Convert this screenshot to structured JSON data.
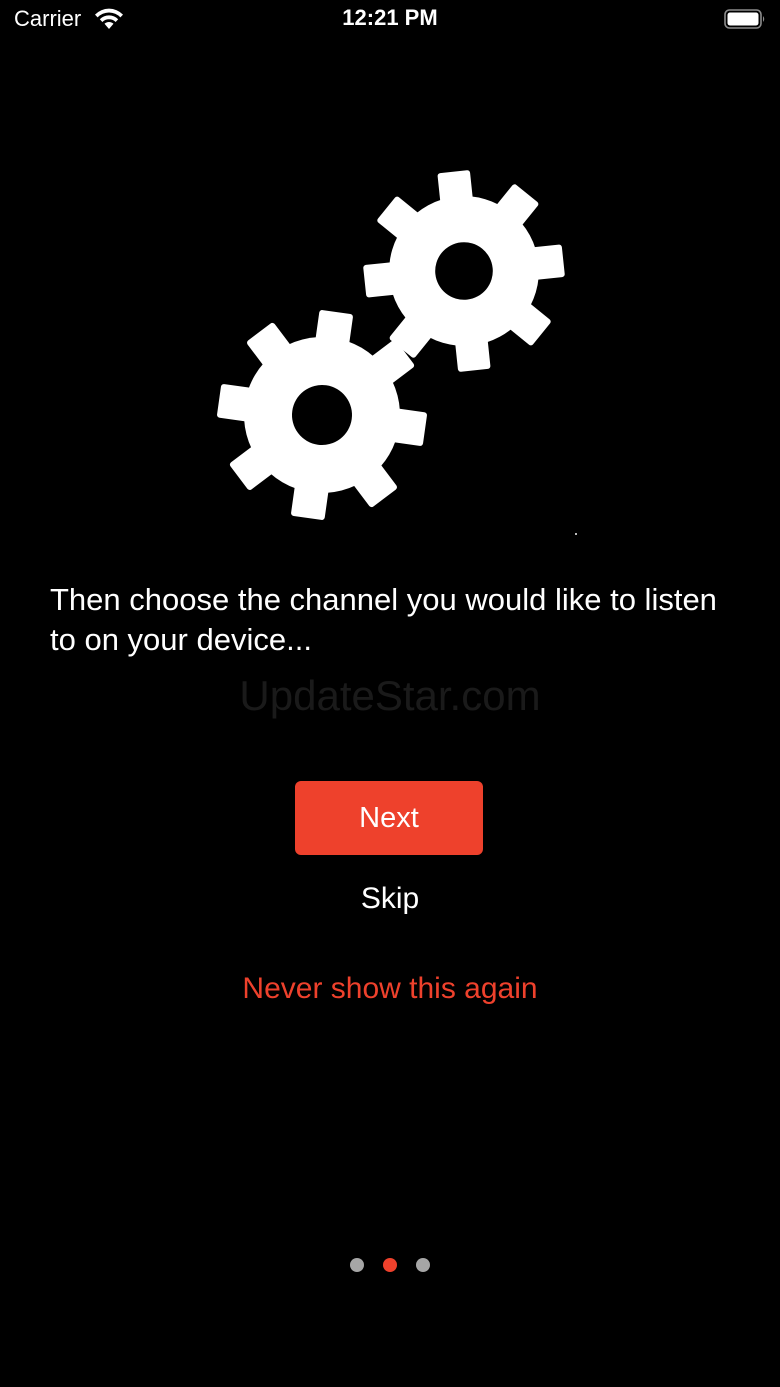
{
  "status_bar": {
    "carrier": "Carrier",
    "time": "12:21 PM"
  },
  "illustration": {
    "icon": "gears-icon",
    "color": "#ffffff"
  },
  "instruction_text": "Then choose the channel you would like to listen to on your device...",
  "watermark": "UpdateStar.com",
  "buttons": {
    "next_label": "Next",
    "skip_label": "Skip",
    "never_show_label": "Never show this again"
  },
  "pager": {
    "total_pages": 3,
    "current_page": 2
  },
  "colors": {
    "accent": "#ee412c",
    "background": "#000000",
    "text": "#ffffff",
    "inactive_dot": "#a6a6a6"
  }
}
